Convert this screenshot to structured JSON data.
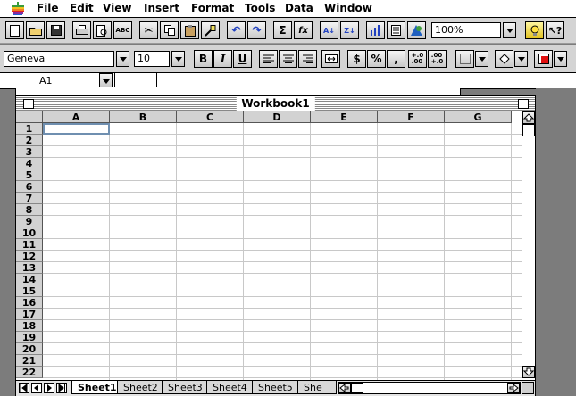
{
  "menubar": {
    "items": [
      "File",
      "Edit",
      "View",
      "Insert",
      "Format",
      "Tools",
      "Data",
      "Window"
    ]
  },
  "toolbar1": {
    "zoom": "100%"
  },
  "toolbar2": {
    "font": "Geneva",
    "size": "10",
    "bold": "B",
    "italic": "I",
    "underline": "U",
    "currency": "$",
    "percent": "%",
    "comma": ","
  },
  "formula_bar": {
    "cell_ref": "A1"
  },
  "workbook": {
    "title": "Workbook1",
    "columns": [
      "A",
      "B",
      "C",
      "D",
      "E",
      "F",
      "G"
    ],
    "rows": [
      "1",
      "2",
      "3",
      "4",
      "5",
      "6",
      "7",
      "8",
      "9",
      "10",
      "11",
      "12",
      "13",
      "14",
      "15",
      "16",
      "17",
      "18",
      "19",
      "20",
      "21",
      "22"
    ],
    "sheets": [
      "Sheet1",
      "Sheet2",
      "Sheet3",
      "Sheet4",
      "Sheet5",
      "She"
    ]
  },
  "colors": {
    "toolbar_bg": "#d4d4d4",
    "desktop_bg": "#7c7c7c",
    "selection": "#6f8fb0"
  }
}
